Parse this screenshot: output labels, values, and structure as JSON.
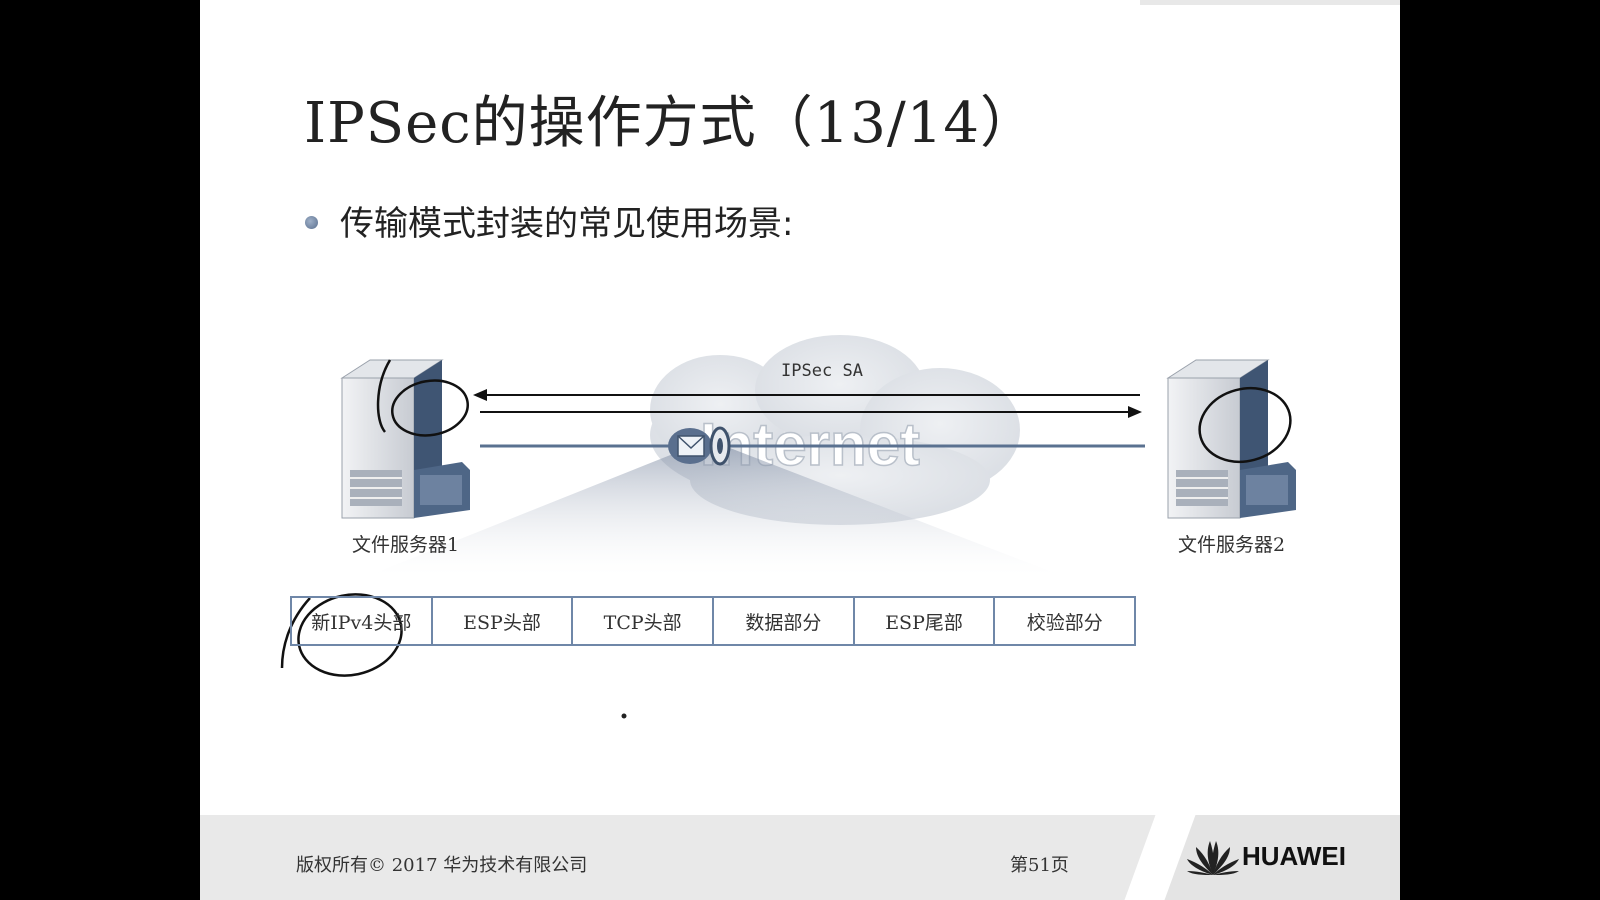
{
  "slide": {
    "title": "IPSec的操作方式（13/14）",
    "bullet": "传输模式封装的常见使用场景:"
  },
  "diagram": {
    "sa_label": "IPSec SA",
    "cloud_text": "Internet",
    "server_left_label": "文件服务器1",
    "server_right_label": "文件服务器2",
    "packet_fields": [
      "新IPv4头部",
      "ESP头部",
      "TCP头部",
      "数据部分",
      "ESP尾部",
      "校验部分"
    ]
  },
  "footer": {
    "copyright": "版权所有© 2017 华为技术有限公司",
    "page": "第51页",
    "brand": "HUAWEI"
  },
  "colors": {
    "slide_bg": "#ffffff",
    "outer_bg": "#000000",
    "accent_line": "#5a7190",
    "footer_bg": "#e9e9e9"
  }
}
